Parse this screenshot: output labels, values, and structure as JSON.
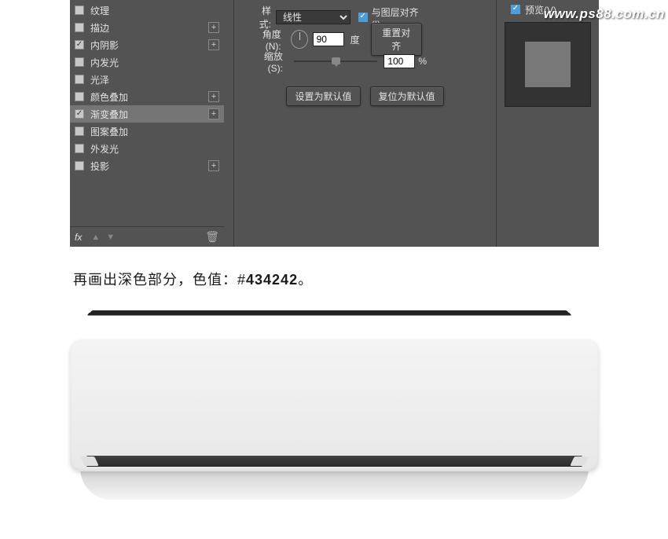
{
  "watermark": "www.ps88.com.cn",
  "styles": {
    "items": [
      {
        "label": "纹理",
        "checked": false,
        "plus": false
      },
      {
        "label": "描边",
        "checked": false,
        "plus": true
      },
      {
        "label": "内阴影",
        "checked": true,
        "plus": true
      },
      {
        "label": "内发光",
        "checked": false,
        "plus": false
      },
      {
        "label": "光泽",
        "checked": false,
        "plus": false
      },
      {
        "label": "颜色叠加",
        "checked": false,
        "plus": true
      },
      {
        "label": "渐变叠加",
        "checked": true,
        "plus": true,
        "selected": true
      },
      {
        "label": "图案叠加",
        "checked": false,
        "plus": false
      },
      {
        "label": "外发光",
        "checked": false,
        "plus": false
      },
      {
        "label": "投影",
        "checked": false,
        "plus": true
      }
    ],
    "fx": "fx"
  },
  "settings": {
    "style_label": "样式:",
    "style_value": "线性",
    "align_label": "与图层对齐(I)",
    "angle_label": "角度(N):",
    "angle_value": "90",
    "angle_unit": "度",
    "reset_align": "重置对齐",
    "scale_label": "缩放(S):",
    "scale_value": "100",
    "scale_unit": "%",
    "set_default": "设置为默认值",
    "reset_default": "复位为默认值"
  },
  "right": {
    "preview_label": "预览(V)"
  },
  "caption": {
    "prefix": "再画出深色部分，色值：#",
    "code": "434242",
    "suffix": "。"
  }
}
